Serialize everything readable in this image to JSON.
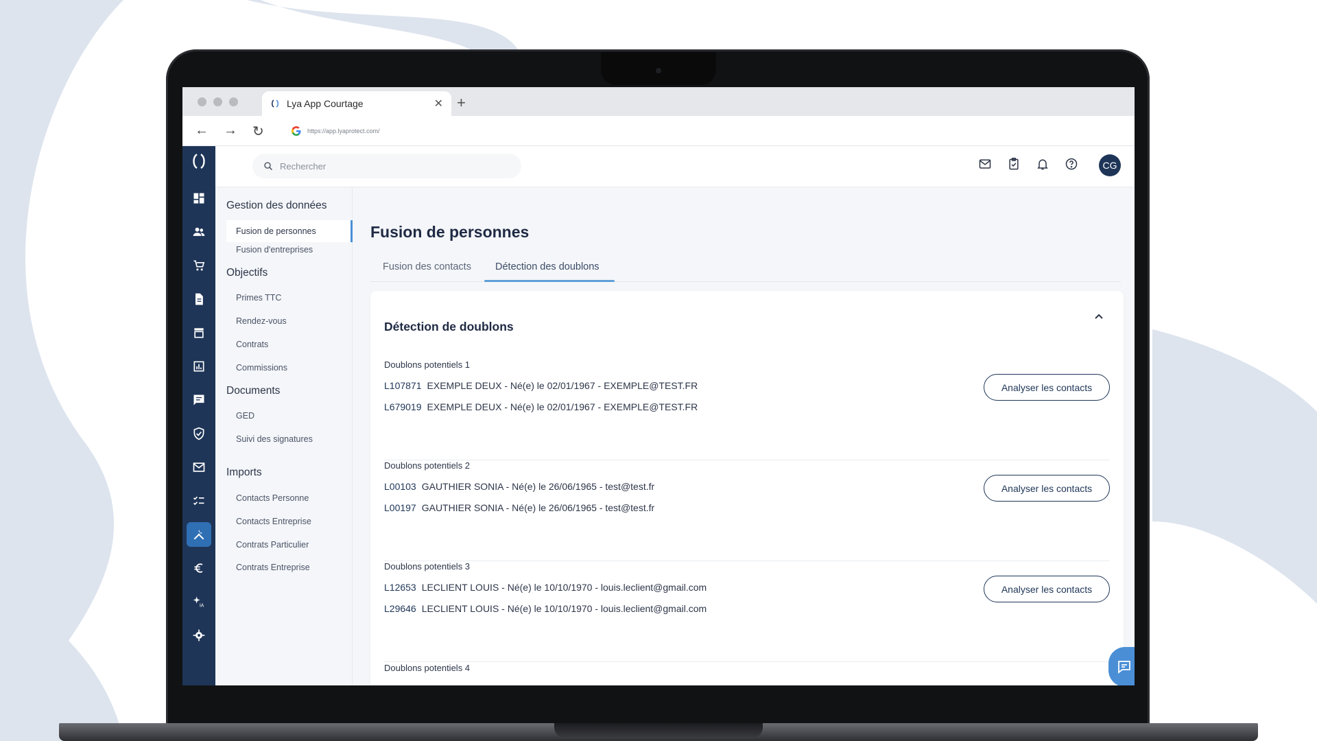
{
  "browser": {
    "tab_title": "Lya App Courtage",
    "url": "https://app.lyaprotect.com/"
  },
  "colors": {
    "rail": "#1e3557",
    "accent": "#4a8fd6",
    "active_rail": "#2f6fb4"
  },
  "topbar": {
    "search_placeholder": "Rechercher",
    "avatar_initials": "CG",
    "icons": [
      "mail-icon",
      "task-check-icon",
      "bell-icon",
      "help-icon"
    ]
  },
  "rail": {
    "icons": [
      "dashboard-icon",
      "people-icon",
      "cart-icon",
      "document-icon",
      "store-icon",
      "chart-icon",
      "message-icon",
      "shield-icon",
      "mail-icon",
      "checklist-icon",
      "tools-icon",
      "euro-icon",
      "ai-sparkle-icon",
      "settings-icon"
    ],
    "active": "tools-icon"
  },
  "subnav": {
    "sections": [
      {
        "title": "Gestion des données",
        "items": [
          "Fusion de personnes",
          "Fusion d'entreprises"
        ]
      },
      {
        "title": "Objectifs",
        "items": [
          "Primes TTC",
          "Rendez-vous",
          "Contrats",
          "Commissions"
        ]
      },
      {
        "title": "Documents",
        "items": [
          "GED",
          "Suivi des signatures"
        ]
      },
      {
        "title": "Imports",
        "items": [
          "Contacts Personne",
          "Contacts Entreprise",
          "Contrats Particulier",
          "Contrats Entreprise"
        ]
      }
    ],
    "active_item": "Fusion de personnes"
  },
  "main": {
    "title": "Fusion de personnes",
    "tabs": [
      "Fusion des contacts",
      "Détection des doublons"
    ],
    "active_tab": "Détection des doublons",
    "card_title": "Détection de doublons",
    "button_label": "Analyser les contacts",
    "groups": [
      {
        "label": "Doublons potentiels 1",
        "records": [
          {
            "code": "L107871",
            "text": "EXEMPLE DEUX - Né(e) le 02/01/1967 - EXEMPLE@TEST.FR"
          },
          {
            "code": "L679019",
            "text": "EXEMPLE DEUX - Né(e) le 02/01/1967 - EXEMPLE@TEST.FR"
          }
        ]
      },
      {
        "label": "Doublons potentiels 2",
        "records": [
          {
            "code": "L00103",
            "text": "GAUTHIER SONIA - Né(e) le 26/06/1965 - test@test.fr"
          },
          {
            "code": "L00197",
            "text": "GAUTHIER SONIA - Né(e) le 26/06/1965 - test@test.fr"
          }
        ]
      },
      {
        "label": "Doublons potentiels 3",
        "records": [
          {
            "code": "L12653",
            "text": "LECLIENT LOUIS - Né(e) le 10/10/1970 - louis.leclient@gmail.com"
          },
          {
            "code": "L29646",
            "text": "LECLIENT LOUIS - Né(e) le 10/10/1970 - louis.leclient@gmail.com"
          }
        ]
      }
    ],
    "next_group_label": "Doublons potentiels 4"
  }
}
